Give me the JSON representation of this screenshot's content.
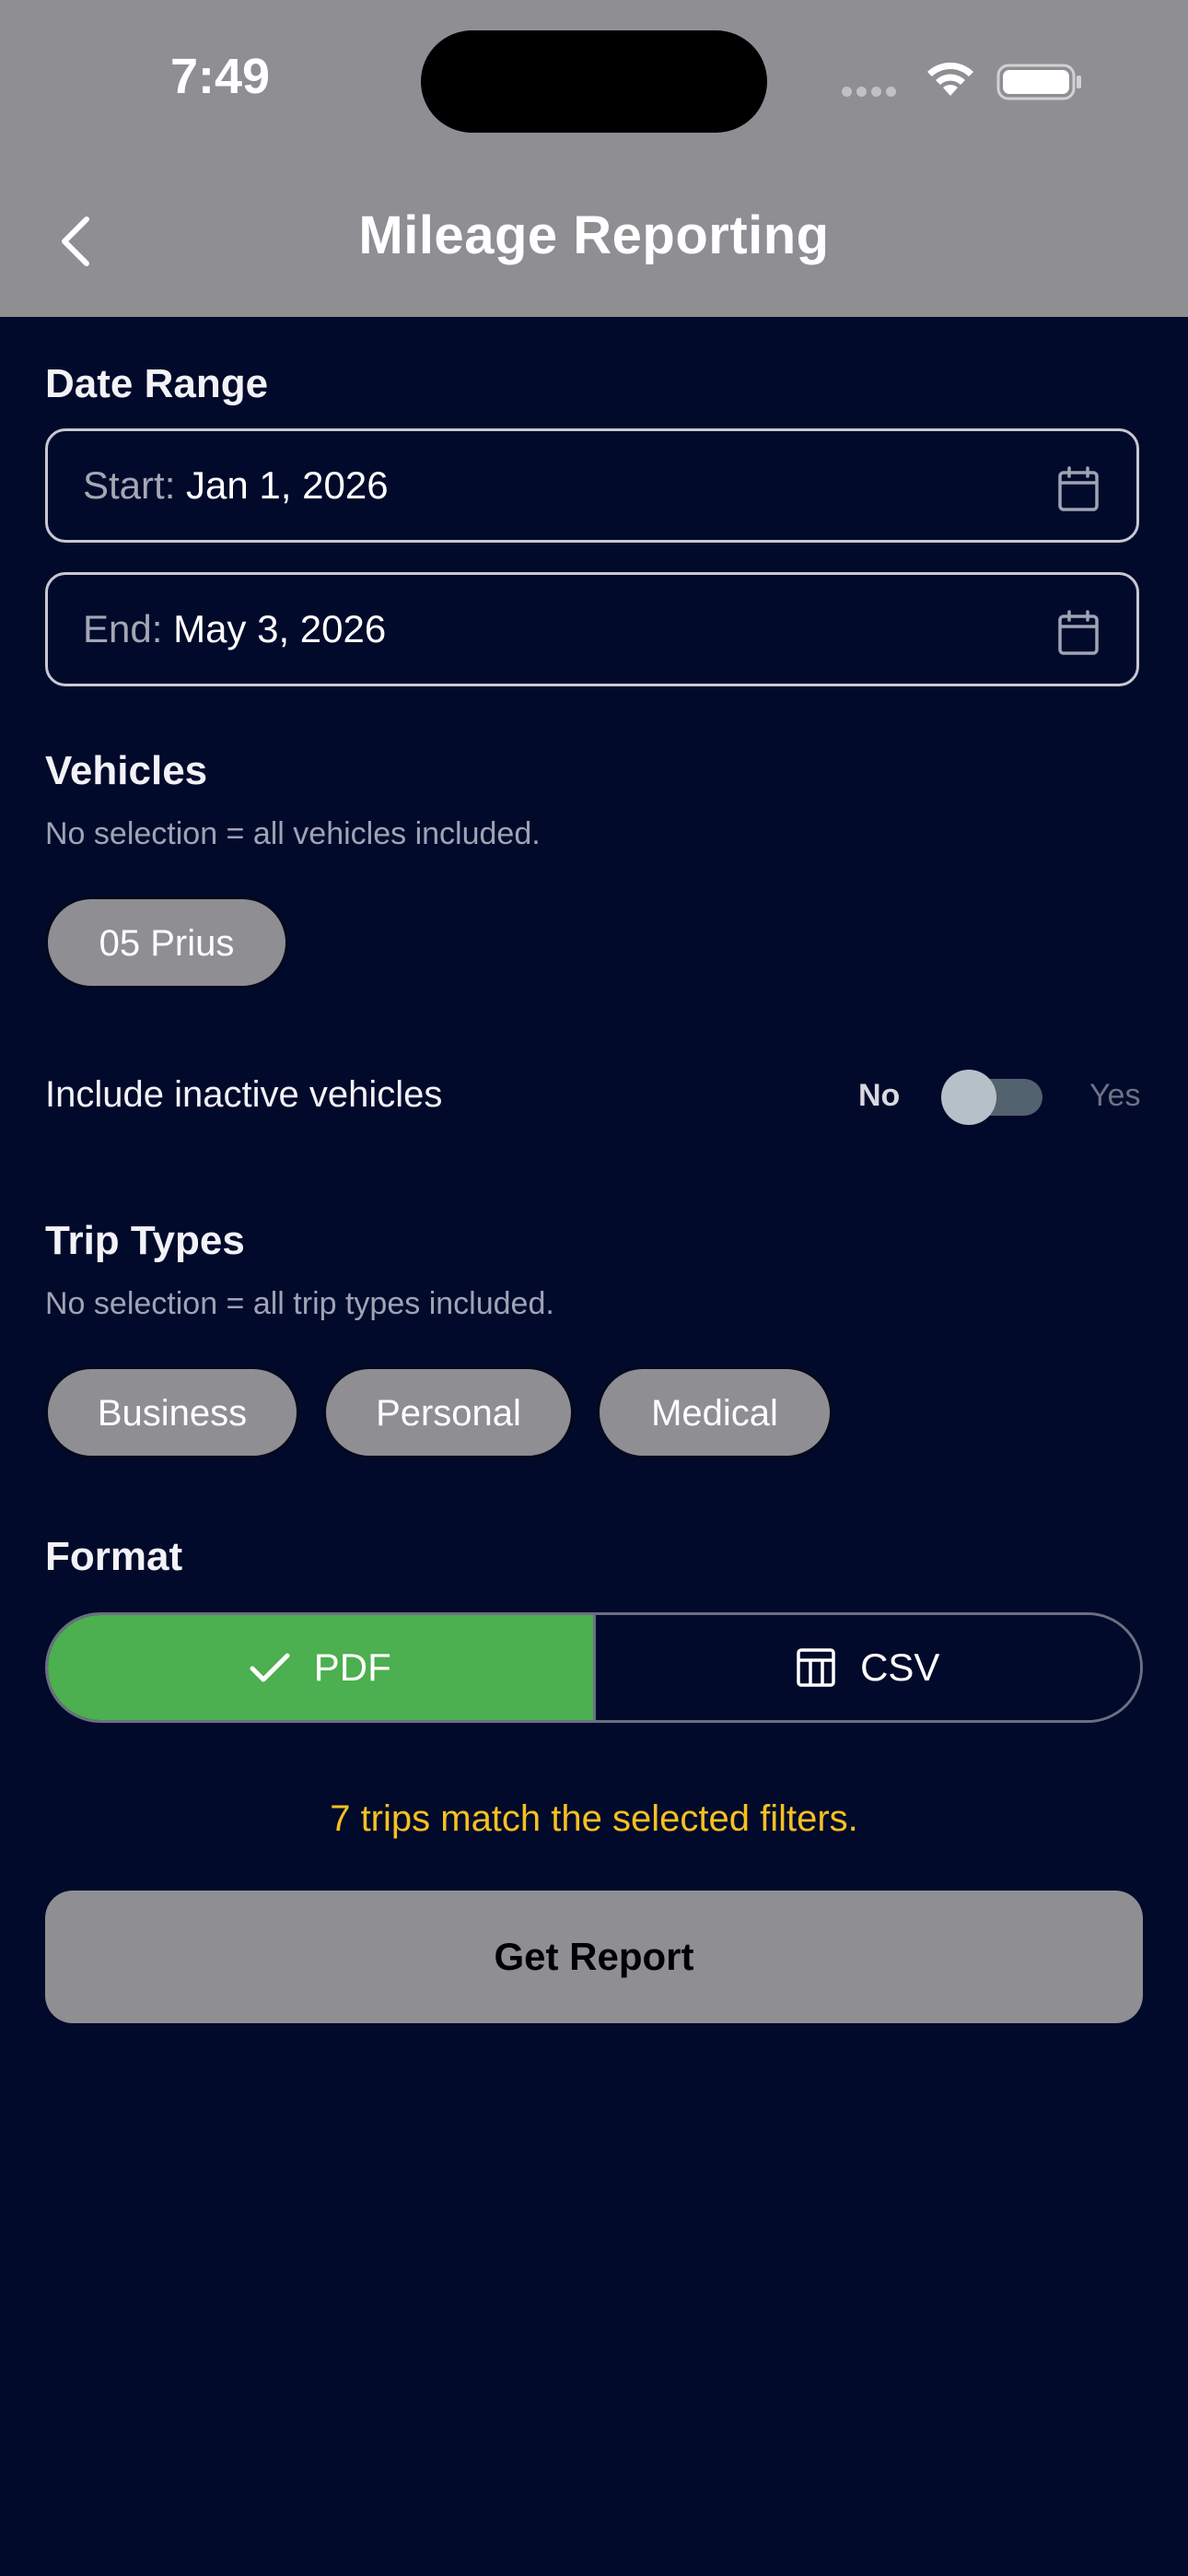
{
  "status_bar": {
    "time": "7:49"
  },
  "nav": {
    "title": "Mileage Reporting",
    "back_icon": "chevron-left-icon"
  },
  "date_range": {
    "title": "Date Range",
    "start_prefix": "Start:",
    "start_value": "Jan 1, 2026",
    "end_prefix": "End:",
    "end_value": "May 3, 2026",
    "icon": "calendar-icon"
  },
  "vehicles": {
    "title": "Vehicles",
    "helper": "No selection = all vehicles included.",
    "chips": [
      "05 Prius"
    ]
  },
  "inactive_toggle": {
    "label": "Include inactive vehicles",
    "off_label": "No",
    "on_label": "Yes",
    "value": false
  },
  "trip_types": {
    "title": "Trip Types",
    "helper": "No selection = all trip types included.",
    "chips": [
      "Business",
      "Personal",
      "Medical"
    ]
  },
  "format": {
    "title": "Format",
    "options": [
      "PDF",
      "CSV"
    ],
    "selected": "PDF",
    "pdf_icon": "checkmark-icon",
    "csv_icon": "table-icon"
  },
  "match_text": "7 trips match the selected filters.",
  "report_button": "Get Report",
  "colors": {
    "background": "#020a2b",
    "header": "#8e8e93",
    "selected_format": "#4caf50",
    "match_text": "#f6c020"
  }
}
